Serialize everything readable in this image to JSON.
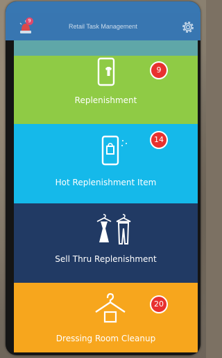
{
  "app": {
    "title": "Retail Task Management"
  },
  "header": {
    "alarm_badge": "9"
  },
  "tiles": [
    {
      "label": "Replenishment",
      "count": "9",
      "color": "#8fcb45",
      "icon": "phone-shirt-icon"
    },
    {
      "label": "Hot Replenishment Item",
      "count": "14",
      "color": "#15b9ea",
      "icon": "phone-bag-icon"
    },
    {
      "label": "Sell Thru Replenishment",
      "count": "",
      "color": "#213a64",
      "icon": "clothes-on-hangers-icon"
    },
    {
      "label": "Dressing Room Cleanup",
      "count": "20",
      "color": "#f7a61d",
      "icon": "hanger-icon"
    }
  ],
  "colors": {
    "header": "#3a7ab7",
    "badge": "#e8312f"
  }
}
